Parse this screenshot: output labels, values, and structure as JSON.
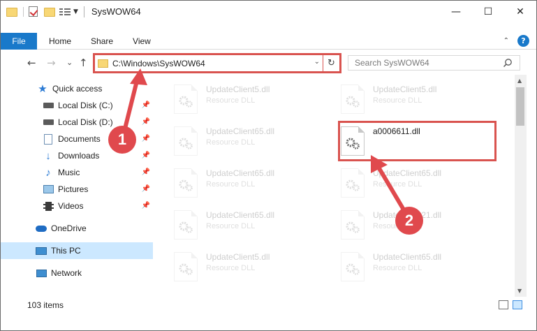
{
  "titlebar": {
    "title": "SysWOW64",
    "minimize": "—",
    "maximize": "☐",
    "close": "✕"
  },
  "ribbon": {
    "tabs": [
      "File",
      "Home",
      "Share",
      "View"
    ],
    "collapse_glyph": "⌃",
    "help_glyph": "?"
  },
  "address": {
    "path": "C:\\Windows\\SysWOW64",
    "refresh_glyph": "↻",
    "back_glyph": "←",
    "forward_glyph": "→",
    "recent_glyph": "⌄",
    "up_glyph": "↑"
  },
  "search": {
    "placeholder": "Search SysWOW64"
  },
  "sidebar": {
    "items": [
      {
        "label": "Quick access",
        "icon": "star-icon",
        "pinned": false
      },
      {
        "label": "Local Disk (C:)",
        "icon": "drive-icon",
        "pinned": true
      },
      {
        "label": "Local Disk (D:)",
        "icon": "drive-icon",
        "pinned": true
      },
      {
        "label": "Documents",
        "icon": "documents-icon",
        "pinned": true
      },
      {
        "label": "Downloads",
        "icon": "download-icon",
        "pinned": true
      },
      {
        "label": "Music",
        "icon": "music-icon",
        "pinned": true
      },
      {
        "label": "Pictures",
        "icon": "pictures-icon",
        "pinned": true
      },
      {
        "label": "Videos",
        "icon": "videos-icon",
        "pinned": true
      },
      {
        "label": "OneDrive",
        "icon": "cloud-icon",
        "pinned": false
      },
      {
        "label": "This PC",
        "icon": "computer-icon",
        "pinned": false,
        "selected": true
      },
      {
        "label": "Network",
        "icon": "network-icon",
        "pinned": false
      }
    ]
  },
  "files": [
    {
      "name": "UpdateClient5.dll",
      "type": "Resource DLL"
    },
    {
      "name": "UpdateClient5.dll",
      "type": "Resource DLL"
    },
    {
      "name": "UpdateClient65.dll",
      "type": "Resource DLL"
    },
    {
      "name": "a0006611.dll",
      "type": ""
    },
    {
      "name": "UpdateClient65.dll",
      "type": "Resource DLL"
    },
    {
      "name": "UpdateClient65.dll",
      "type": "Resource DLL"
    },
    {
      "name": "UpdateClient65.dll",
      "type": "Resource DLL"
    },
    {
      "name": "UpdateClient21.dll",
      "type": "Resource DLL"
    },
    {
      "name": "UpdateClient5.dll",
      "type": "Resource DLL"
    },
    {
      "name": "UpdateClient65.dll",
      "type": "Resource DLL"
    }
  ],
  "status": {
    "count": "103 items"
  },
  "annotations": {
    "step1": "1",
    "step2": "2",
    "color": "#e0494d"
  }
}
